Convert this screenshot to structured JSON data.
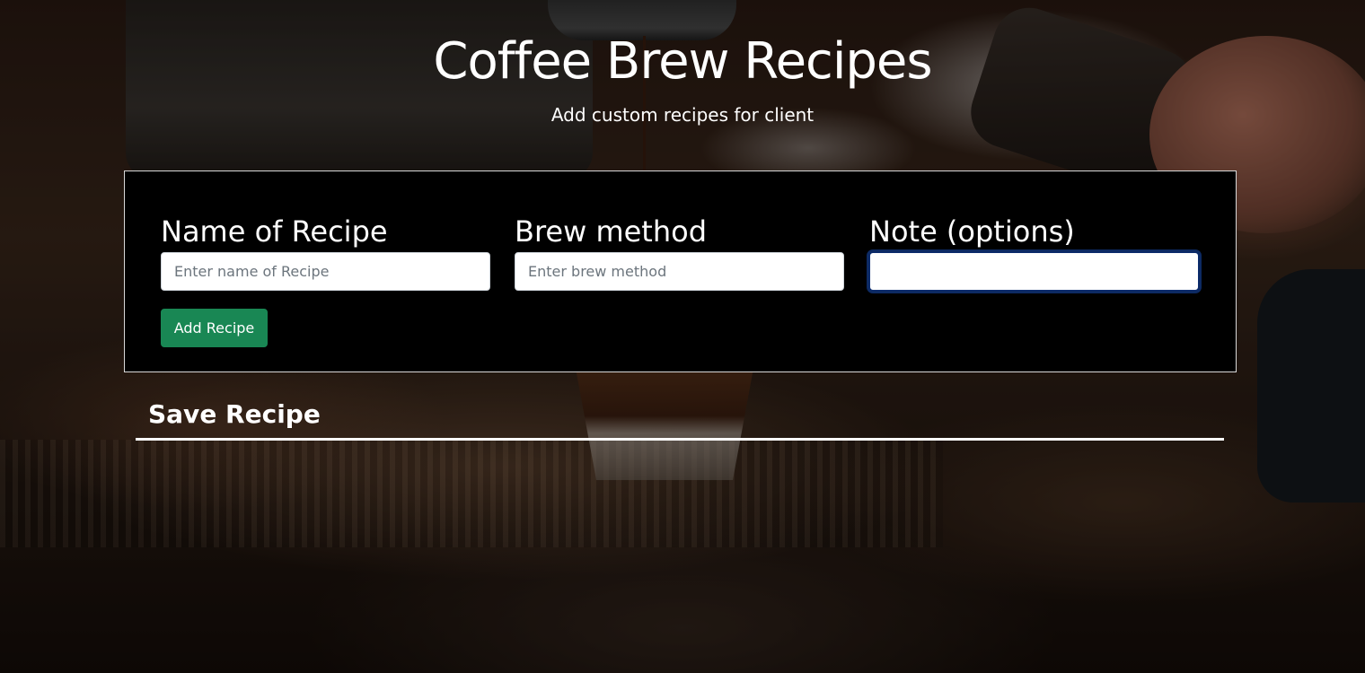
{
  "header": {
    "title": "Coffee Brew Recipes",
    "subtitle": "Add custom recipes for client"
  },
  "form": {
    "fields": [
      {
        "label": "Name of Recipe",
        "placeholder": "Enter name of Recipe",
        "value": ""
      },
      {
        "label": "Brew method",
        "placeholder": "Enter brew method",
        "value": ""
      },
      {
        "label": "Note (options)",
        "placeholder": "",
        "value": ""
      }
    ],
    "submit_label": "Add Recipe"
  },
  "saved": {
    "heading": "Save Recipe",
    "items": []
  },
  "colors": {
    "card_background": "#000000",
    "card_border": "#d9d9d9",
    "button_green": "#198754",
    "focus_ring": "#0d2a63",
    "text": "#ffffff"
  },
  "background": {
    "description_icon": "coffee-espresso-photo"
  }
}
